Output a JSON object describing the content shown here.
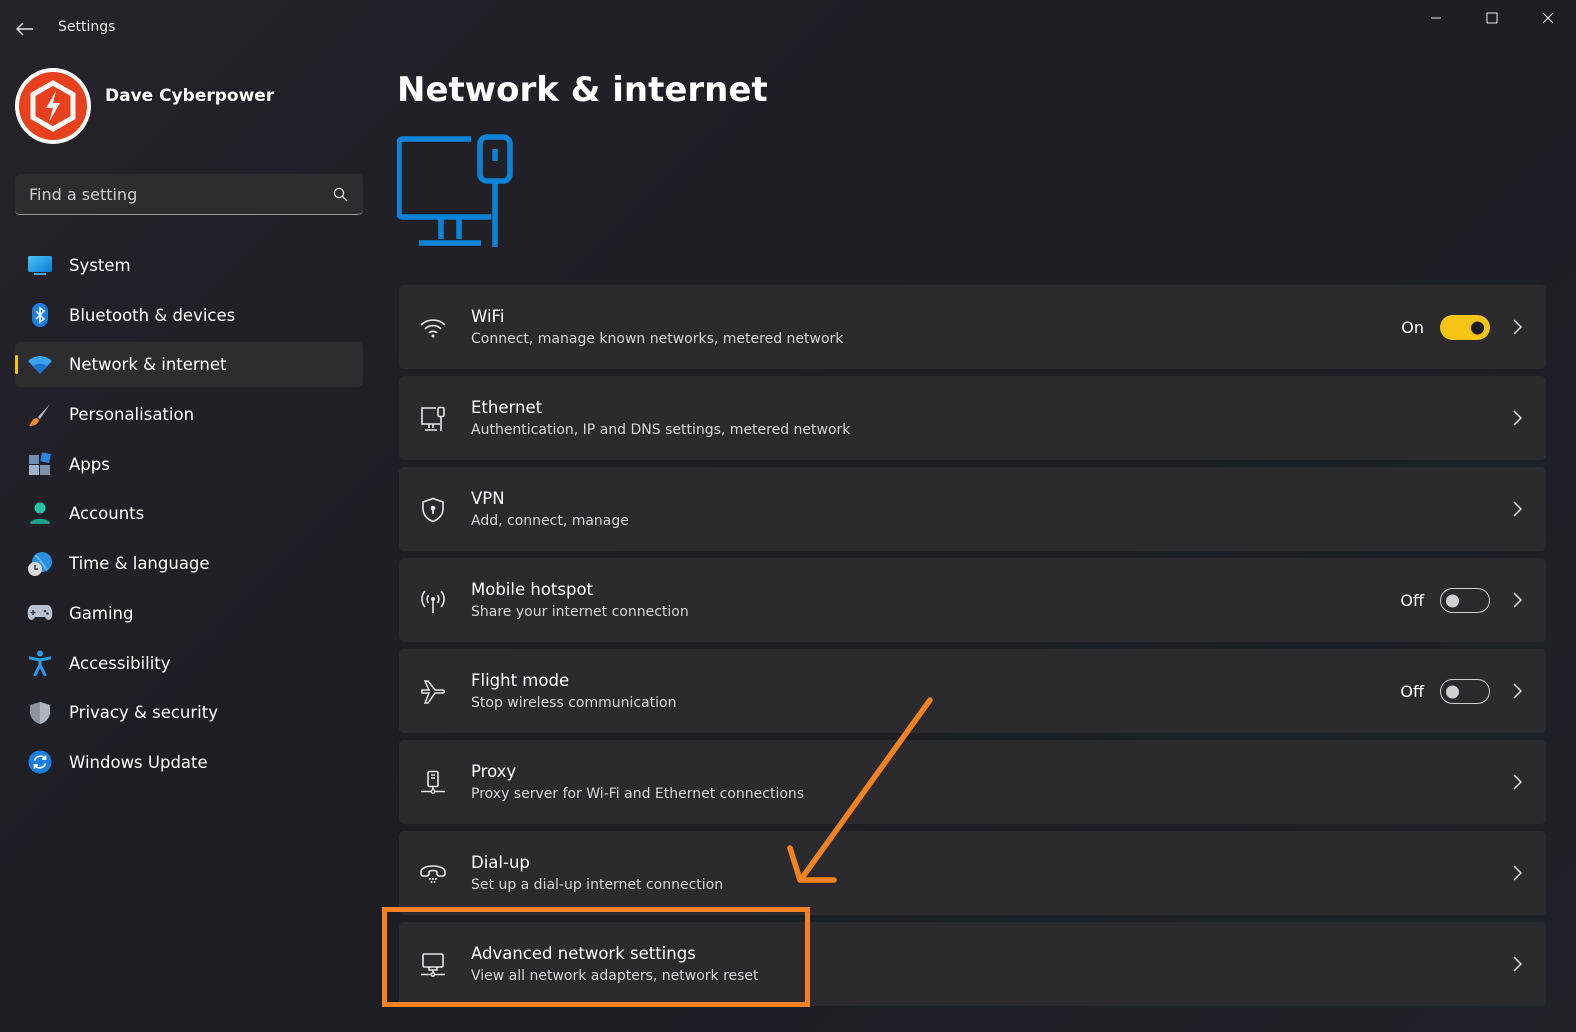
{
  "window": {
    "title": "Settings"
  },
  "profile": {
    "name": "Dave Cyberpower"
  },
  "search": {
    "placeholder": "Find a setting"
  },
  "sidebar": {
    "items": [
      {
        "label": "System",
        "icon": "system-icon"
      },
      {
        "label": "Bluetooth & devices",
        "icon": "bluetooth-icon"
      },
      {
        "label": "Network & internet",
        "icon": "wifi-icon",
        "active": true
      },
      {
        "label": "Personalisation",
        "icon": "brush-icon"
      },
      {
        "label": "Apps",
        "icon": "apps-icon"
      },
      {
        "label": "Accounts",
        "icon": "account-icon"
      },
      {
        "label": "Time & language",
        "icon": "globe-clock-icon"
      },
      {
        "label": "Gaming",
        "icon": "gamepad-icon"
      },
      {
        "label": "Accessibility",
        "icon": "accessibility-icon"
      },
      {
        "label": "Privacy & security",
        "icon": "shield-icon"
      },
      {
        "label": "Windows Update",
        "icon": "update-icon"
      }
    ]
  },
  "main": {
    "title": "Network & internet",
    "rows": [
      {
        "title": "WiFi",
        "subtitle": "Connect, manage known networks, metered network",
        "icon": "wifi-icon",
        "toggle": "On"
      },
      {
        "title": "Ethernet",
        "subtitle": "Authentication, IP and DNS settings, metered network",
        "icon": "ethernet-icon"
      },
      {
        "title": "VPN",
        "subtitle": "Add, connect, manage",
        "icon": "vpn-shield-icon"
      },
      {
        "title": "Mobile hotspot",
        "subtitle": "Share your internet connection",
        "icon": "hotspot-icon",
        "toggle": "Off"
      },
      {
        "title": "Flight mode",
        "subtitle": "Stop wireless communication",
        "icon": "airplane-icon",
        "toggle": "Off"
      },
      {
        "title": "Proxy",
        "subtitle": "Proxy server for Wi-Fi and Ethernet connections",
        "icon": "proxy-icon"
      },
      {
        "title": "Dial-up",
        "subtitle": "Set up a dial-up internet connection",
        "icon": "dialup-icon"
      },
      {
        "title": "Advanced network settings",
        "subtitle": "View all network adapters, network reset",
        "icon": "advanced-network-icon"
      }
    ]
  },
  "colors": {
    "accent": "#f7c414",
    "annotation": "#f58220",
    "windows_blue": "#0a84d8"
  }
}
